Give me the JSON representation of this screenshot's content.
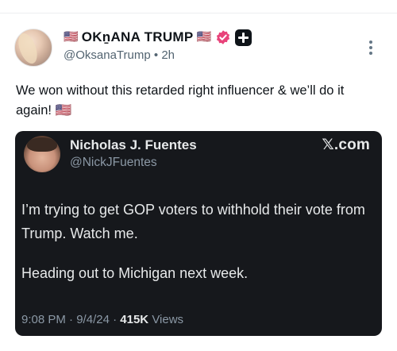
{
  "author": {
    "flag_left": "🇺🇸",
    "display_name": "OKṉANA TRUMP",
    "flag_right": "🇺🇸",
    "handle": "@OksanaTrump",
    "time_separator": "•",
    "timestamp": "2h"
  },
  "post": {
    "text": "We won without this retarded right influencer & we’ll do it again! 🇺🇸"
  },
  "quoted": {
    "name": "Nicholas J. Fuentes",
    "handle": "@NickJFuentes",
    "platform": "𝕏.com",
    "paragraphs": [
      "I’m trying to get GOP voters to withhold their vote from Trump. Watch me.",
      "Heading out to Michigan next week."
    ],
    "time": "9:08 PM",
    "date": "9/4/24",
    "separator": "·",
    "views_count": "415K",
    "views_label": "Views"
  },
  "colors": {
    "verified_badge": "#e8437a",
    "card_background": "#16181c",
    "muted_text": "#536471"
  },
  "icons": {
    "verified": "verified-badge-icon",
    "plus": "plus-badge-icon",
    "more": "more-vertical-icon"
  }
}
